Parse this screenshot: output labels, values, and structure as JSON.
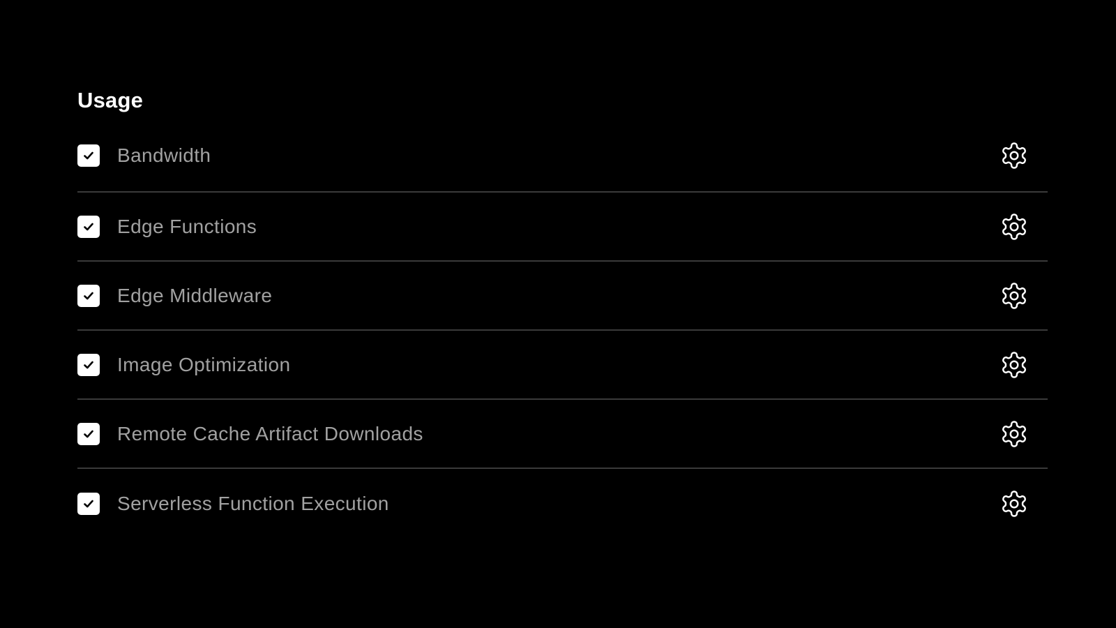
{
  "section": {
    "title": "Usage"
  },
  "items": [
    {
      "label": "Bandwidth",
      "checked": true,
      "settings_icon": "gear-icon",
      "check_icon": "checkmark-icon"
    },
    {
      "label": "Edge Functions",
      "checked": true,
      "settings_icon": "gear-icon",
      "check_icon": "checkmark-icon"
    },
    {
      "label": "Edge Middleware",
      "checked": true,
      "settings_icon": "gear-icon",
      "check_icon": "checkmark-icon"
    },
    {
      "label": "Image Optimization",
      "checked": true,
      "settings_icon": "gear-icon",
      "check_icon": "checkmark-icon"
    },
    {
      "label": "Remote Cache Artifact Downloads",
      "checked": true,
      "settings_icon": "gear-icon",
      "check_icon": "checkmark-icon"
    },
    {
      "label": "Serverless Function Execution",
      "checked": true,
      "settings_icon": "gear-icon",
      "check_icon": "checkmark-icon"
    }
  ],
  "colors": {
    "background": "#000000",
    "title": "#ffffff",
    "label": "#a1a1a1",
    "divider": "#3a3a3a",
    "checkbox_fill": "#ffffff",
    "checkmark": "#000000",
    "gear": "#ffffff"
  }
}
